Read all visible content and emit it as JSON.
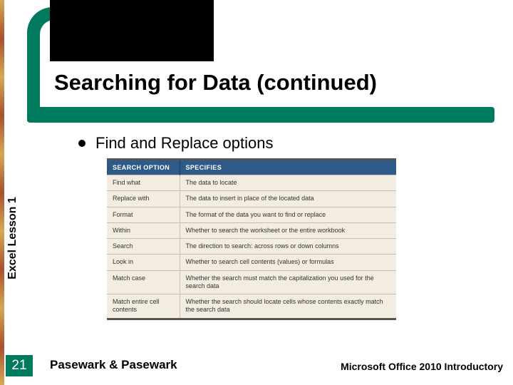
{
  "header": {
    "title": "Searching for Data (continued)"
  },
  "sidebar": {
    "label": "Excel Lesson 1"
  },
  "bullet": {
    "text": "Find and Replace options"
  },
  "table": {
    "headers": [
      "SEARCH OPTION",
      "SPECIFIES"
    ],
    "rows": [
      {
        "option": "Find what",
        "specifies": "The data to locate"
      },
      {
        "option": "Replace with",
        "specifies": "The data to insert in place of the located data"
      },
      {
        "option": "Format",
        "specifies": "The format of the data you want to find or replace"
      },
      {
        "option": "Within",
        "specifies": "Whether to search the worksheet or the entire workbook"
      },
      {
        "option": "Search",
        "specifies": "The direction to search: across rows or down columns"
      },
      {
        "option": "Look in",
        "specifies": "Whether to search cell contents (values) or formulas"
      },
      {
        "option": "Match case",
        "specifies": "Whether the search must match the capitalization you used for the search data"
      },
      {
        "option": "Match entire cell contents",
        "specifies": "Whether the search should locate cells whose contents exactly match the search data"
      }
    ]
  },
  "footer": {
    "page": "21",
    "left": "Pasewark & Pasewark",
    "right": "Microsoft Office 2010 Introductory"
  }
}
